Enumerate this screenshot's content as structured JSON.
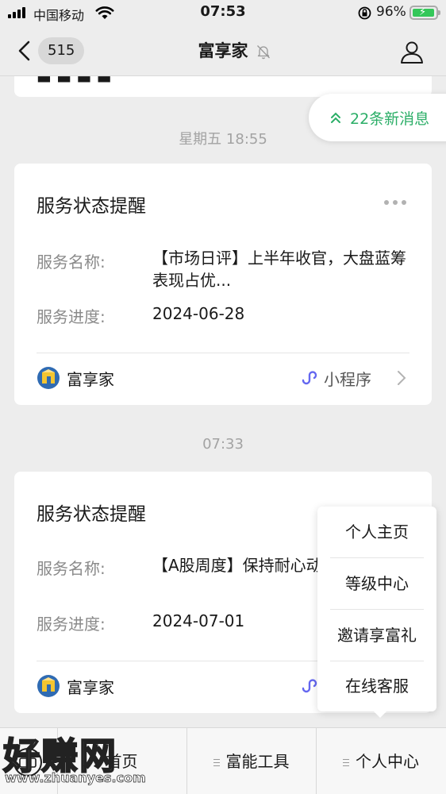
{
  "status_bar": {
    "carrier": "中国移动",
    "time": "07:53",
    "battery": "96%"
  },
  "nav": {
    "unread_count": "515",
    "title": "富享家"
  },
  "new_messages": "22条新消息",
  "messages": [
    {
      "timestamp": "星期五 18:55",
      "title": "服务状态提醒",
      "name_label": "服务名称:",
      "name_value": "【市场日评】上半年收官，大盘蓝筹表现占优...",
      "progress_label": "服务进度:",
      "progress_value": "2024-06-28",
      "app_name": "富享家",
      "mini_program": "小程序"
    },
    {
      "timestamp": "07:33",
      "title": "服务状态提醒",
      "name_label": "服务名称:",
      "name_value": "【A股周度】保持耐心动",
      "progress_label": "服务进度:",
      "progress_value": "2024-07-01",
      "app_name": "富享家"
    }
  ],
  "popup_menu": [
    "个人主页",
    "等级中心",
    "邀请享富礼",
    "在线客服"
  ],
  "bottom_menu": [
    "首页",
    "富能工具",
    "个人中心"
  ],
  "watermark": {
    "text": "好赚网",
    "url": "www.zhuanyes.com"
  },
  "colors": {
    "accent_green": "#2bae67",
    "background": "#ededed"
  }
}
